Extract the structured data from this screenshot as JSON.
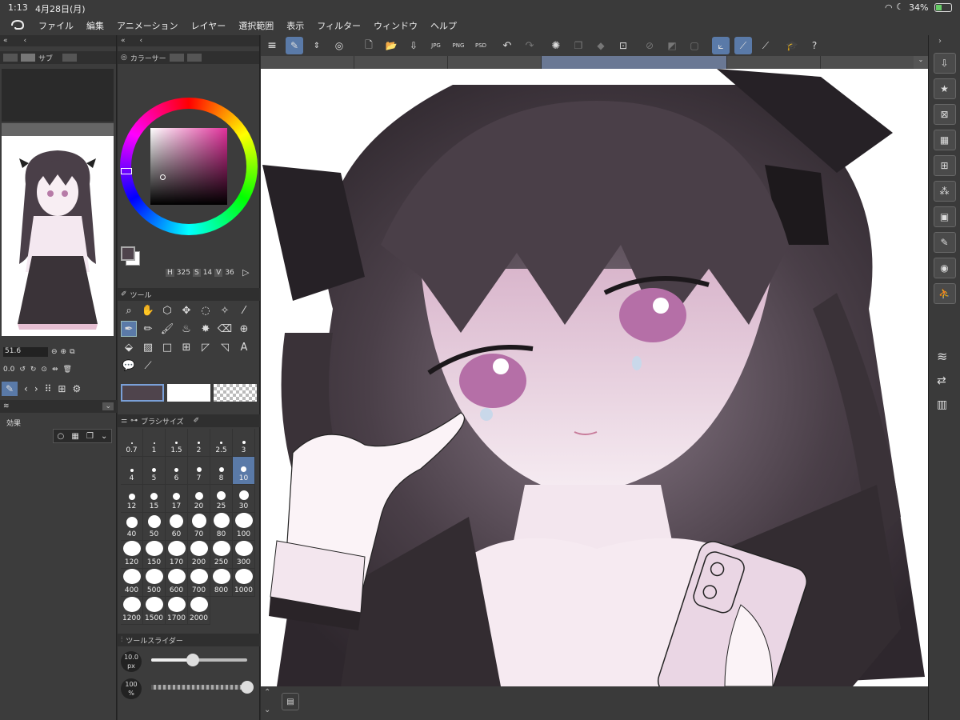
{
  "status": {
    "time": "1:13",
    "date": "4月28日(月)",
    "battery": "34%"
  },
  "menu": [
    "ファイル",
    "編集",
    "アニメーション",
    "レイヤー",
    "選択範囲",
    "表示",
    "フィルター",
    "ウィンドウ",
    "ヘルプ"
  ],
  "left_panel": {
    "tab_sub": "サブ",
    "zoom_value": "51.6",
    "rotate_value": "0.0",
    "effects_label": "効果"
  },
  "color_panel": {
    "tab_label": "カラーサー",
    "h_label": "H",
    "h_value": "325",
    "s_label": "S",
    "s_value": "14",
    "v_label": "V",
    "v_value": "36"
  },
  "tool_panel": {
    "title": "ツール"
  },
  "brush_size_panel": {
    "title": "ブラシサイズ",
    "sizes": [
      "0.7",
      "1",
      "1.5",
      "2",
      "2.5",
      "3",
      "4",
      "5",
      "6",
      "7",
      "8",
      "10",
      "12",
      "15",
      "17",
      "20",
      "25",
      "30",
      "40",
      "50",
      "60",
      "70",
      "80",
      "100",
      "120",
      "150",
      "170",
      "200",
      "250",
      "300",
      "400",
      "500",
      "600",
      "700",
      "800",
      "1000",
      "1200",
      "1500",
      "1700",
      "2000"
    ],
    "selected": "10"
  },
  "tool_slider": {
    "title": "ツールスライダー",
    "size_value": "10.0",
    "size_unit": "px",
    "opacity_value": "100",
    "opacity_unit": "%",
    "size_fraction": 0.43,
    "opacity_fraction": 1.0
  },
  "colors": {
    "accent": "#5a7aa8",
    "main_color": "#4f444c",
    "sub_color": "#ffffff"
  }
}
